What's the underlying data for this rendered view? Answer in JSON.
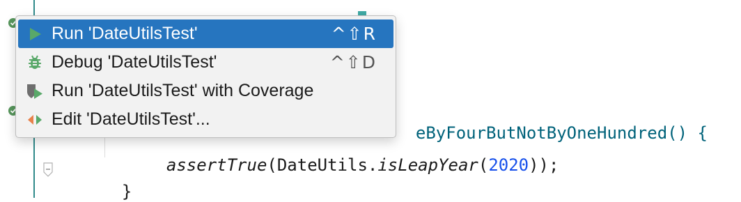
{
  "editor": {
    "code_fragment_1": "eByFourButNotByOneHundred() {",
    "code_assert_fn": "assertTrue",
    "code_assert_mid": "(DateUtils.",
    "code_assert_call": "isLeapYear",
    "code_paren_open": "(",
    "code_year": "2020",
    "code_end": "));",
    "code_close_brace": "}"
  },
  "menu": {
    "items": [
      {
        "label": "Run 'DateUtilsTest'",
        "shortcut": "^⇧R",
        "icon": "run-icon",
        "selected": true
      },
      {
        "label": "Debug 'DateUtilsTest'",
        "shortcut": "^⇧D",
        "icon": "debug-icon",
        "selected": false
      },
      {
        "label": "Run 'DateUtilsTest' with Coverage",
        "shortcut": "",
        "icon": "coverage-icon",
        "selected": false
      },
      {
        "label": "Edit 'DateUtilsTest'...",
        "shortcut": "",
        "icon": "edit-config-icon",
        "selected": false
      }
    ]
  },
  "colors": {
    "selection": "#2675bf",
    "run_green": "#59a869",
    "gutter_check": "#57965c",
    "number_blue": "#1750eb"
  }
}
